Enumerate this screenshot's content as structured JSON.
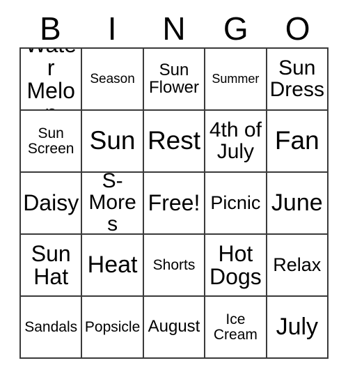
{
  "card": {
    "title": "BINGO",
    "header_letters": [
      "B",
      "I",
      "N",
      "G",
      "O"
    ],
    "grid_size": "5x5",
    "border_color": "#3a3a3a",
    "background_color": "#ffffff",
    "text_color": "#000000",
    "rows": [
      [
        {
          "label": "Water\nMelon",
          "size": "fs-md",
          "free": false
        },
        {
          "label": "Season",
          "size": "fs-tiny",
          "free": false
        },
        {
          "label": "Sun\nFlower",
          "size": "fs-xs",
          "free": false
        },
        {
          "label": "Summer",
          "size": "fs-min",
          "free": false
        },
        {
          "label": "Sun\nDress",
          "size": "fs-sm2",
          "free": false
        }
      ],
      [
        {
          "label": "Sun\nScreen",
          "size": "fs-xxs",
          "free": false
        },
        {
          "label": "Sun",
          "size": "fs-xl",
          "free": false
        },
        {
          "label": "Rest",
          "size": "fs-xl",
          "free": false
        },
        {
          "label": "4th of\nJuly",
          "size": "fs-sm2",
          "free": false
        },
        {
          "label": "Fan",
          "size": "fs-xl",
          "free": false
        }
      ],
      [
        {
          "label": "Daisy",
          "size": "fs-md",
          "free": false
        },
        {
          "label": "S-\nMores",
          "size": "fs-sm2",
          "free": false
        },
        {
          "label": "Free!",
          "size": "fs-md",
          "free": true
        },
        {
          "label": "Picnic",
          "size": "fs-sm",
          "free": false
        },
        {
          "label": "June",
          "size": "fs-lg",
          "free": false
        }
      ],
      [
        {
          "label": "Sun\nHat",
          "size": "fs-md",
          "free": false
        },
        {
          "label": "Heat",
          "size": "fs-lg",
          "free": false
        },
        {
          "label": "Shorts",
          "size": "fs-xxs",
          "free": false
        },
        {
          "label": "Hot\nDogs",
          "size": "fs-md",
          "free": false
        },
        {
          "label": "Relax",
          "size": "fs-sm",
          "free": false
        }
      ],
      [
        {
          "label": "Sandals",
          "size": "fs-xxs",
          "free": false
        },
        {
          "label": "Popsicle",
          "size": "fs-xxs",
          "free": false
        },
        {
          "label": "August",
          "size": "fs-xs",
          "free": false
        },
        {
          "label": "Ice\nCream",
          "size": "fs-xxs",
          "free": false
        },
        {
          "label": "July",
          "size": "fs-lg",
          "free": false
        }
      ]
    ]
  }
}
